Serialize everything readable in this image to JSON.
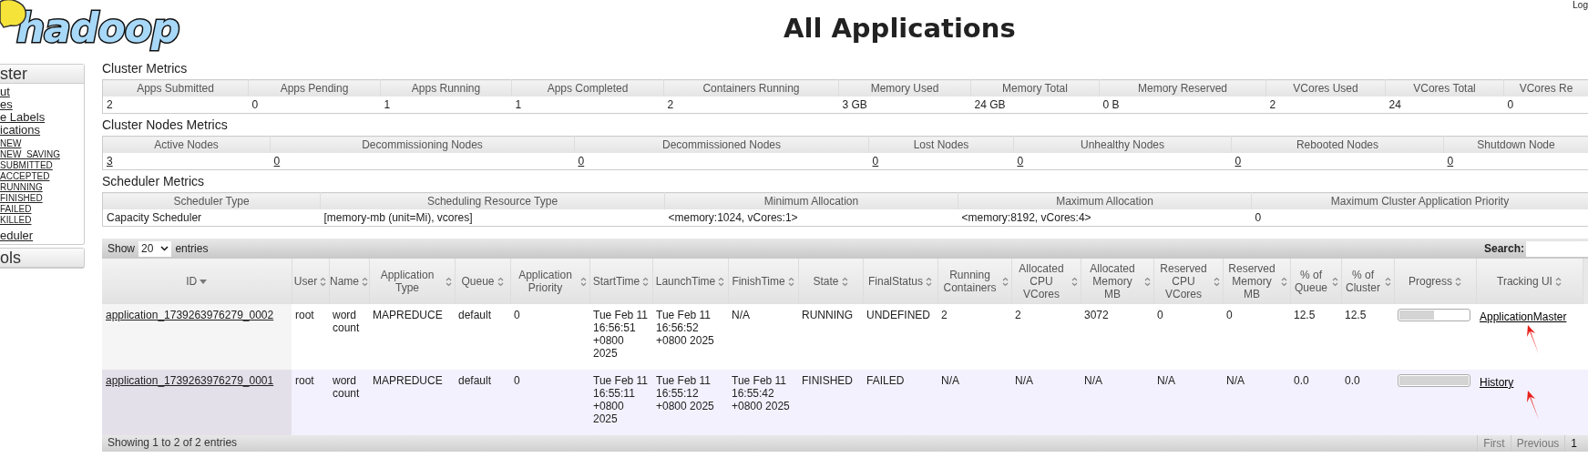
{
  "logo": {
    "text": "hadoop"
  },
  "title": "All Applications",
  "login": "Log",
  "sidebar": [
    {
      "title": "ster",
      "items": [
        {
          "label": "ut"
        },
        {
          "label": "es"
        },
        {
          "label": "e Labels"
        },
        {
          "label": "ications",
          "children": [
            {
              "label": "NEW"
            },
            {
              "label": "NEW_SAVING"
            },
            {
              "label": "SUBMITTED"
            },
            {
              "label": "ACCEPTED"
            },
            {
              "label": "RUNNING"
            },
            {
              "label": "FINISHED"
            },
            {
              "label": "FAILED"
            },
            {
              "label": "KILLED"
            }
          ]
        },
        {
          "label": "eduler"
        }
      ]
    },
    {
      "title": "ols"
    }
  ],
  "metrics": [
    {
      "title": "Cluster Metrics",
      "linked": false,
      "columns": [
        "Apps Submitted",
        "Apps Pending",
        "Apps Running",
        "Apps Completed",
        "Containers Running",
        "Memory Used",
        "Memory Total",
        "Memory Reserved",
        "VCores Used",
        "VCores Total",
        "VCores Re"
      ],
      "values": [
        "2",
        "0",
        "1",
        "1",
        "2",
        "3 GB",
        "24 GB",
        "0 B",
        "2",
        "24",
        "0"
      ]
    },
    {
      "title": "Cluster Nodes Metrics",
      "linked": true,
      "columns": [
        "Active Nodes",
        "Decommissioning Nodes",
        "Decommissioned Nodes",
        "Lost Nodes",
        "Unhealthy Nodes",
        "Rebooted Nodes",
        "Shutdown Node"
      ],
      "values": [
        "3",
        "0",
        "0",
        "0",
        "0",
        "0",
        "0"
      ]
    },
    {
      "title": "Scheduler Metrics",
      "linked": false,
      "columns": [
        "Scheduler Type",
        "Scheduling Resource Type",
        "Minimum Allocation",
        "Maximum Allocation",
        "Maximum Cluster Application Priority"
      ],
      "values": [
        "Capacity Scheduler",
        "[memory-mb (unit=Mi), vcores]",
        "<memory:1024, vCores:1>",
        "<memory:8192, vCores:4>",
        "0"
      ]
    }
  ],
  "apps": {
    "show_label": "Show",
    "page_size": "20",
    "entries_label": "entries",
    "search_label": "Search:",
    "columns": [
      {
        "label": "ID",
        "sorted": true
      },
      {
        "label": "User",
        "sorted": false
      },
      {
        "label": "Name",
        "sorted": false
      },
      {
        "label": "Application Type",
        "sorted": false
      },
      {
        "label": "Queue",
        "sorted": false
      },
      {
        "label": "Application Priority",
        "sorted": false
      },
      {
        "label": "StartTime",
        "sorted": false
      },
      {
        "label": "LaunchTime",
        "sorted": false
      },
      {
        "label": "FinishTime",
        "sorted": false
      },
      {
        "label": "State",
        "sorted": false
      },
      {
        "label": "FinalStatus",
        "sorted": false
      },
      {
        "label": "Running Containers",
        "sorted": false
      },
      {
        "label": "Allocated CPU VCores",
        "sorted": false
      },
      {
        "label": "Allocated Memory MB",
        "sorted": false
      },
      {
        "label": "Reserved CPU VCores",
        "sorted": false
      },
      {
        "label": "Reserved Memory MB",
        "sorted": false
      },
      {
        "label": "% of Queue",
        "sorted": false
      },
      {
        "label": "% of Cluster",
        "sorted": false
      },
      {
        "label": "Progress",
        "sorted": false
      },
      {
        "label": "Tracking UI",
        "sorted": false
      }
    ],
    "rows": [
      {
        "cells": [
          "application_1739263976279_0002",
          "root",
          "word count",
          "MAPREDUCE",
          "default",
          "0",
          "Tue Feb 11 16:56:51 +0800 2025",
          "Tue Feb 11 16:56:52 +0800 2025",
          "N/A",
          "RUNNING",
          "UNDEFINED",
          "2",
          "2",
          "3072",
          "0",
          "0",
          "12.5",
          "12.5"
        ],
        "progress": {
          "level": 0.5
        },
        "tracking": "ApplicationMaster"
      },
      {
        "cells": [
          "application_1739263976279_0001",
          "root",
          "word count",
          "MAPREDUCE",
          "default",
          "0",
          "Tue Feb 11 16:55:11 +0800 2025",
          "Tue Feb 11 16:55:12 +0800 2025",
          "Tue Feb 11 16:55:42 +0800 2025",
          "FINISHED",
          "FAILED",
          "N/A",
          "N/A",
          "N/A",
          "N/A",
          "N/A",
          "0.0",
          "0.0"
        ],
        "progress": {
          "level": 1
        },
        "tracking": "History"
      }
    ],
    "info": "Showing 1 to 2 of 2 entries",
    "pager": [
      {
        "label": "First",
        "disabled": true
      },
      {
        "label": "Previous",
        "disabled": true
      },
      {
        "label": "1",
        "disabled": false
      }
    ]
  }
}
